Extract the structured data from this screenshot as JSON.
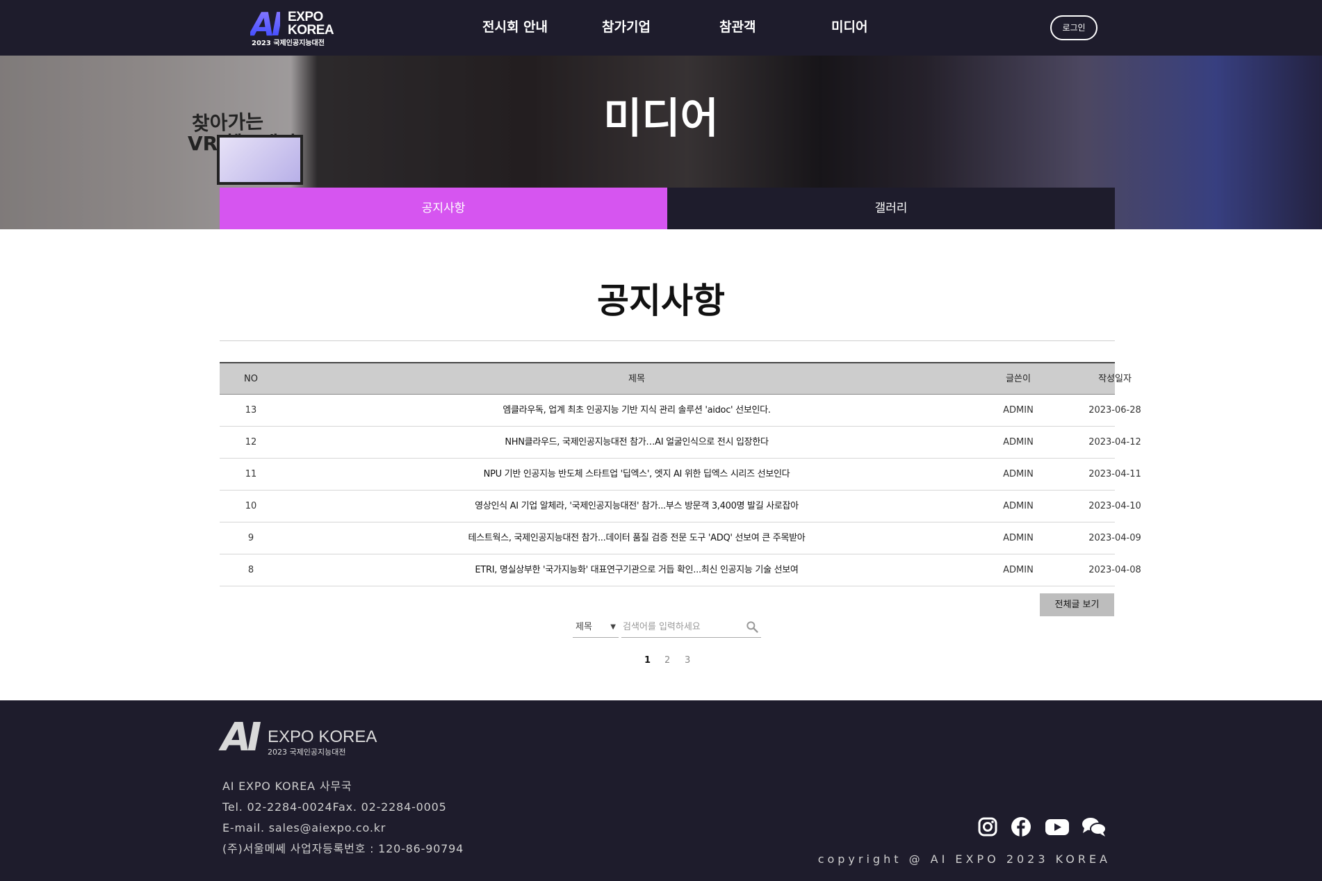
{
  "header": {
    "logo": {
      "ai": "AI",
      "line1": "EXPO",
      "line2": "KOREA",
      "sub": "2023 국제인공지능대전"
    },
    "nav": [
      "전시회 안내",
      "참가기업",
      "참관객",
      "미디어"
    ],
    "login_label": "로그인"
  },
  "hero": {
    "title": "미디어",
    "photo_text_1": "찾아가는",
    "photo_text_2": "VR 헬스케어"
  },
  "tabs": [
    {
      "label": "공지사항",
      "active": true
    },
    {
      "label": "갤러리",
      "active": false
    }
  ],
  "main": {
    "title": "공지사항",
    "columns": {
      "no": "NO",
      "title": "제목",
      "author": "글쓴이",
      "date": "작성일자"
    },
    "rows": [
      {
        "no": "13",
        "title": "엠클라우독, 업계 최초 인공지능 기반 지식 관리 솔루션 'aidoc' 선보인다.",
        "author": "ADMIN",
        "date": "2023-06-28"
      },
      {
        "no": "12",
        "title": "NHN클라우드, 국제인공지능대전 참가…AI 얼굴인식으로 전시 입장한다",
        "author": "ADMIN",
        "date": "2023-04-12"
      },
      {
        "no": "11",
        "title": "NPU 기반 인공지능 반도체 스타트업 '딥엑스', 엣지 AI 위한 딥엑스 시리즈 선보인다",
        "author": "ADMIN",
        "date": "2023-04-11"
      },
      {
        "no": "10",
        "title": "영상인식 AI 기업 알체라, '국제인공지능대전' 참가...부스 방문객 3,400명 발길 사로잡아",
        "author": "ADMIN",
        "date": "2023-04-10"
      },
      {
        "no": "9",
        "title": "테스트웍스, 국제인공지능대전 참가...데이터 품질 검증 전문 도구 'ADQ' 선보여 큰 주목받아",
        "author": "ADMIN",
        "date": "2023-04-09"
      },
      {
        "no": "8",
        "title": "ETRI, 명실상부한 '국가지능화' 대표연구기관으로 거듭 확인...최신 인공지능 기술 선보여",
        "author": "ADMIN",
        "date": "2023-04-08"
      }
    ],
    "view_all_label": "전체글 보기",
    "search": {
      "field_selected": "제목",
      "placeholder": "검색어를 입력하세요"
    },
    "pages": [
      "1",
      "2",
      "3"
    ],
    "current_page": "1"
  },
  "footer": {
    "logo": {
      "ai": "AI",
      "line1": "EXPO KOREA",
      "sub": "2023 국제인공지능대전"
    },
    "office": "AI EXPO KOREA 사무국",
    "tel_fax": "Tel. 02-2284-0024Fax. 02-2284-0005",
    "email": "E-mail. sales@aiexpo.co.kr",
    "registration": "(주)서울메쎄 사업자등록번호 : 120-86-90794",
    "sns_icons": [
      "instagram-icon",
      "facebook-icon",
      "youtube-icon",
      "chat-icon"
    ],
    "copyright": "copyright @ AI EXPO 2023 KOREA"
  },
  "colors": {
    "header_bg": "#1e1c2c",
    "tab_active": "#d655f0",
    "table_head_bg": "#cdcdcd"
  }
}
